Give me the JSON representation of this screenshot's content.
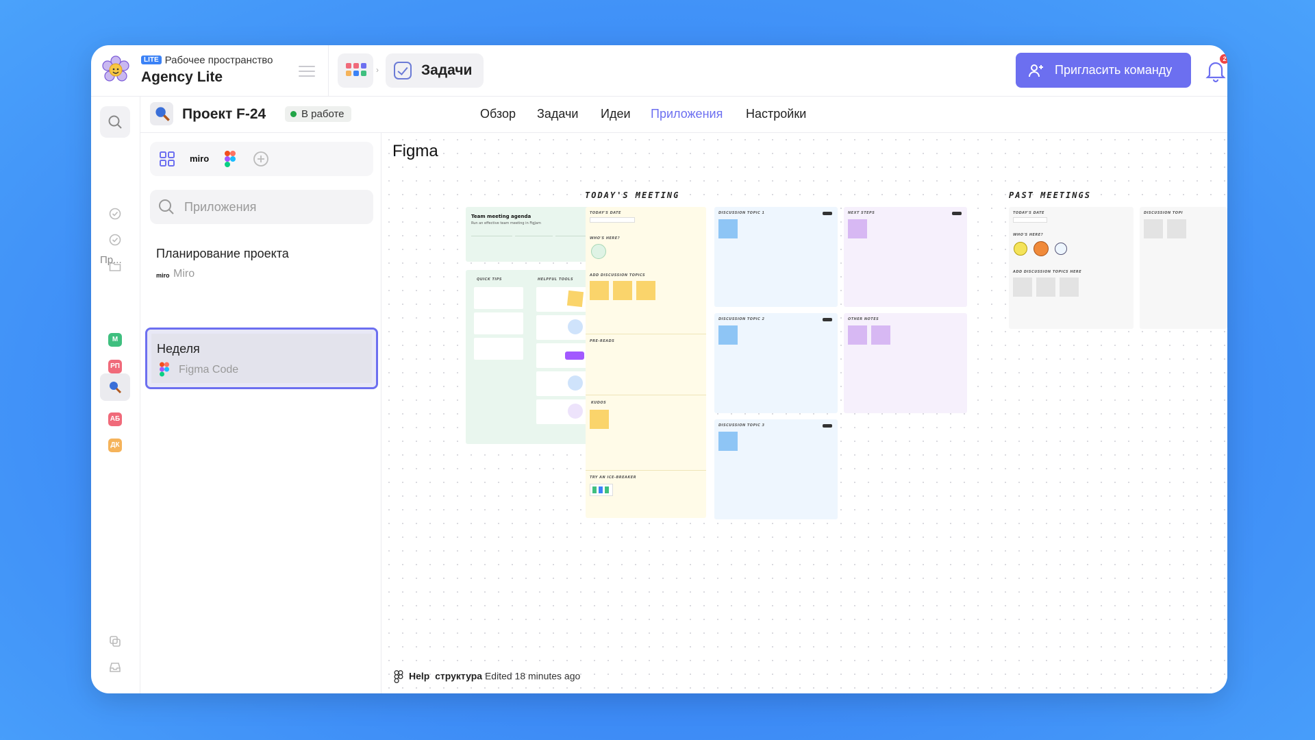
{
  "workspace": {
    "badge": "LITE",
    "label": "Рабочее пространство",
    "name": "Agency Lite"
  },
  "breadcrumb": {
    "current": "Задачи"
  },
  "header": {
    "invite_label": "Пригласить команду",
    "notifications_count": "2"
  },
  "rail": {
    "projects_label": "Пр...",
    "projects": [
      {
        "initials": "M",
        "color": "#3fbf7f"
      },
      {
        "initials": "РП",
        "color": "#f06a7a"
      },
      {
        "initials": "АБ",
        "color": "#f06a7a"
      },
      {
        "initials": "ДК",
        "color": "#f5b35a"
      }
    ]
  },
  "project": {
    "title": "Проект F-24",
    "status": "В работе",
    "tabs": [
      "Обзор",
      "Задачи",
      "Идеи",
      "Приложения",
      "Настройки"
    ],
    "active_tab": "Приложения"
  },
  "apps_panel": {
    "toolbar_items": [
      "grid-icon",
      "miro-logo",
      "figma-logo",
      "add-icon"
    ],
    "miro_label": "miro",
    "search_placeholder": "Приложения",
    "items": [
      {
        "name": "Планирование проекта",
        "source": "Miro",
        "source_logo": "miro"
      },
      {
        "name": "Неделя",
        "source": "Figma Code",
        "source_logo": "figma"
      }
    ]
  },
  "canvas": {
    "title": "Figma",
    "sections": {
      "todays_meeting": "TODAY'S MEETING",
      "past_meetings": "PAST MEETINGS"
    },
    "agenda": {
      "title": "Team meeting agenda",
      "subtitle": "Run an effective team meeting in FigJam",
      "quick_tips": "QUICK TIPS",
      "helpful_tools": "HELPFUL TOOLS"
    },
    "labels": {
      "todays_date": "TODAY'S DATE",
      "whos_here": "WHO'S HERE?",
      "add_topics": "ADD DISCUSSION TOPICS",
      "pre_reads": "PRE-READS",
      "kudos": "KUDOS",
      "ice_breaker": "TRY AN ICE-BREAKER",
      "topic1": "DISCUSSION TOPIC 1",
      "topic2": "DISCUSSION TOPIC 2",
      "topic3": "DISCUSSION TOPIC 3",
      "next_steps": "NEXT STEPS",
      "other_notes": "OTHER NOTES",
      "add_topics_here": "ADD DISCUSSION TOPICS HERE",
      "discussion_topic": "DISCUSSION TOPI"
    },
    "footer": {
      "file_bold": "Help",
      "file_name": "структура",
      "edited": "Edited 18 minutes ago"
    }
  },
  "colors": {
    "accent": "#6c6ff0",
    "status_green": "#22a447",
    "sticky_yellow": "#fad46b",
    "sticky_blue": "#8ec5f5",
    "sticky_purple": "#d7b8f3"
  }
}
